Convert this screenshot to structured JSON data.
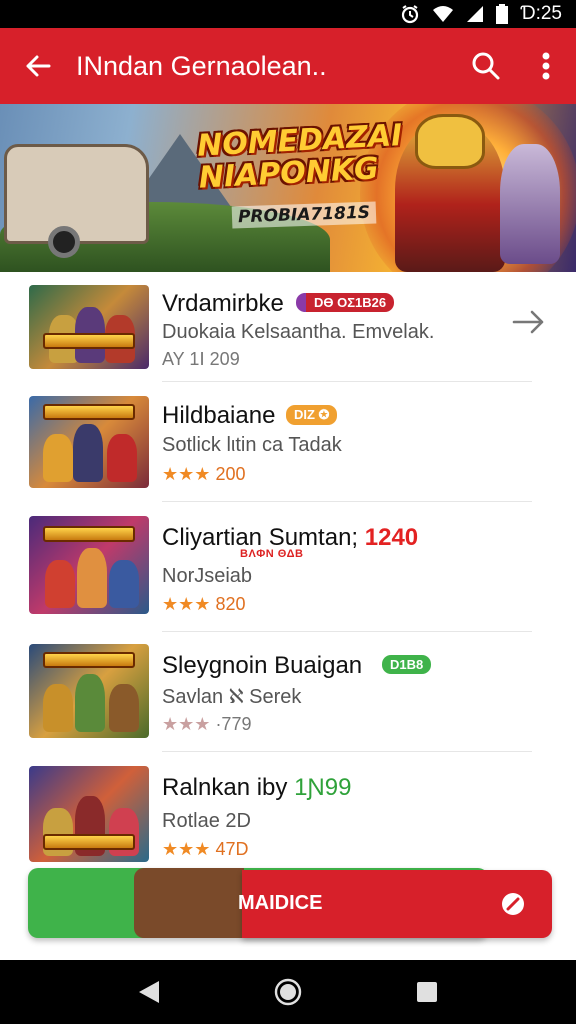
{
  "status_bar": {
    "time": "Ɗ:25",
    "icons": [
      "alarm-icon",
      "wifi-icon",
      "signal-icon",
      "battery-icon"
    ]
  },
  "app_bar": {
    "title": "INndan Gernaolean..",
    "back_icon": "back-arrow-icon",
    "search_icon": "search-icon",
    "menu_icon": "more-vert-icon"
  },
  "banner": {
    "title": "NOMEDAZAI NIAPONKG",
    "subtitle": "PROBIA7181S"
  },
  "items": [
    {
      "title": "Vrdamirbke",
      "badge": "DƟ ΟΣ1Β26",
      "subtitle": "Duokaia  Kelsaantha.  Emvelak.",
      "rating": "AY 1Ⅰ 209"
    },
    {
      "title": "Hildbaiane",
      "badge": "DIZ ✪",
      "subtitle": "Sotlick lιtin ca Tadak",
      "stars": "★★★",
      "rating_value": "200"
    },
    {
      "title": "Cliyartian Sumtan;",
      "price": "1240",
      "tag": "ΒΛΦΝ ΘΔΒ",
      "subtitle": "NorJseiab",
      "stars": "★★★",
      "rating_value": "820"
    },
    {
      "title": "Sleygnoin Buaigan",
      "badge": "D1Β8",
      "subtitle": "Savlan  ℵ Serek",
      "stars": "★★★",
      "rating_value": "·779"
    },
    {
      "title": "Ralnkan iby",
      "price": "1Ɲ99",
      "subtitle": "Rotlae 2D",
      "stars": "★★★",
      "rating_value": "47D"
    }
  ],
  "action": {
    "label": "MAIDICE",
    "icon": "cancel-icon"
  },
  "nav": {
    "back": "nav-back-icon",
    "home": "nav-home-icon",
    "recents": "nav-recents-icon"
  },
  "colors": {
    "primary": "#d7202a",
    "green": "#3fb34a",
    "star": "#f08a24"
  }
}
